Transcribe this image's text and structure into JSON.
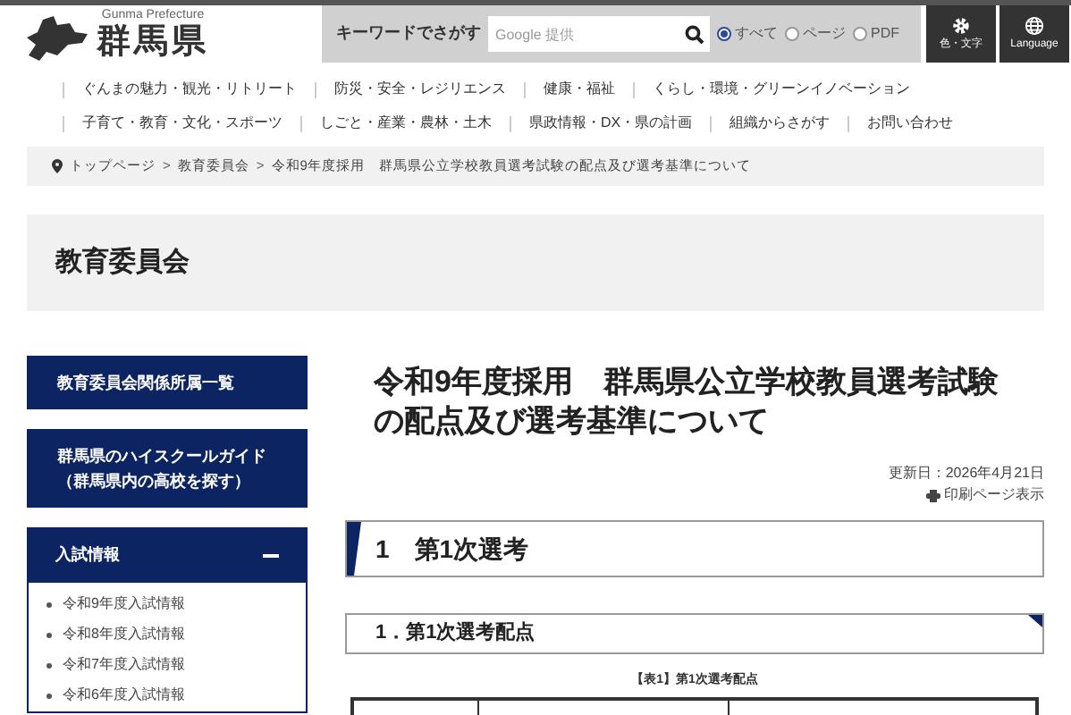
{
  "logo": {
    "subtitle": "Gunma Prefecture",
    "title": "群馬県"
  },
  "search": {
    "label": "キーワードでさがす",
    "placeholder": "Google 提供",
    "options": [
      {
        "label": "すべて",
        "selected": true
      },
      {
        "label": "ページ",
        "selected": false
      },
      {
        "label": "PDF",
        "selected": false
      }
    ]
  },
  "tools": [
    {
      "kind": "gear",
      "label": "色・文字"
    },
    {
      "kind": "globe",
      "label": "Language"
    }
  ],
  "nav": [
    [
      "ぐんまの魅力・観光・リトリート",
      "防災・安全・レジリエンス",
      "健康・福祉",
      "くらし・環境・グリーンイノベーション"
    ],
    [
      "子育て・教育・文化・スポーツ",
      "しごと・産業・農林・土木",
      "県政情報・DX・県の計画",
      "組織からさがす",
      "お問い合わせ"
    ]
  ],
  "breadcrumb": {
    "separator": ">",
    "items": [
      "トップページ",
      "教育委員会",
      "令和9年度採用　群馬県公立学校教員選考試験の配点及び選考基準について"
    ]
  },
  "section_title": "教育委員会",
  "sidebar": {
    "links": [
      "教育委員会関係所属一覧",
      "群馬県のハイスクールガイド（群馬県内の高校を探す）"
    ],
    "accordion": {
      "title": "入試情報",
      "expanded": true,
      "items": [
        "令和9年度入試情報",
        "令和8年度入試情報",
        "令和7年度入試情報",
        "令和6年度入試情報"
      ]
    }
  },
  "article": {
    "title": "令和9年度採用　群馬県公立学校教員選考試験の配点及び選考基準について",
    "updated": "更新日：2026年4月21日",
    "print": "印刷ページ表示",
    "heading": "1　第1次選考",
    "subheading": "1．第1次選考配点",
    "table_caption": "【表1】第1次選考配点"
  }
}
